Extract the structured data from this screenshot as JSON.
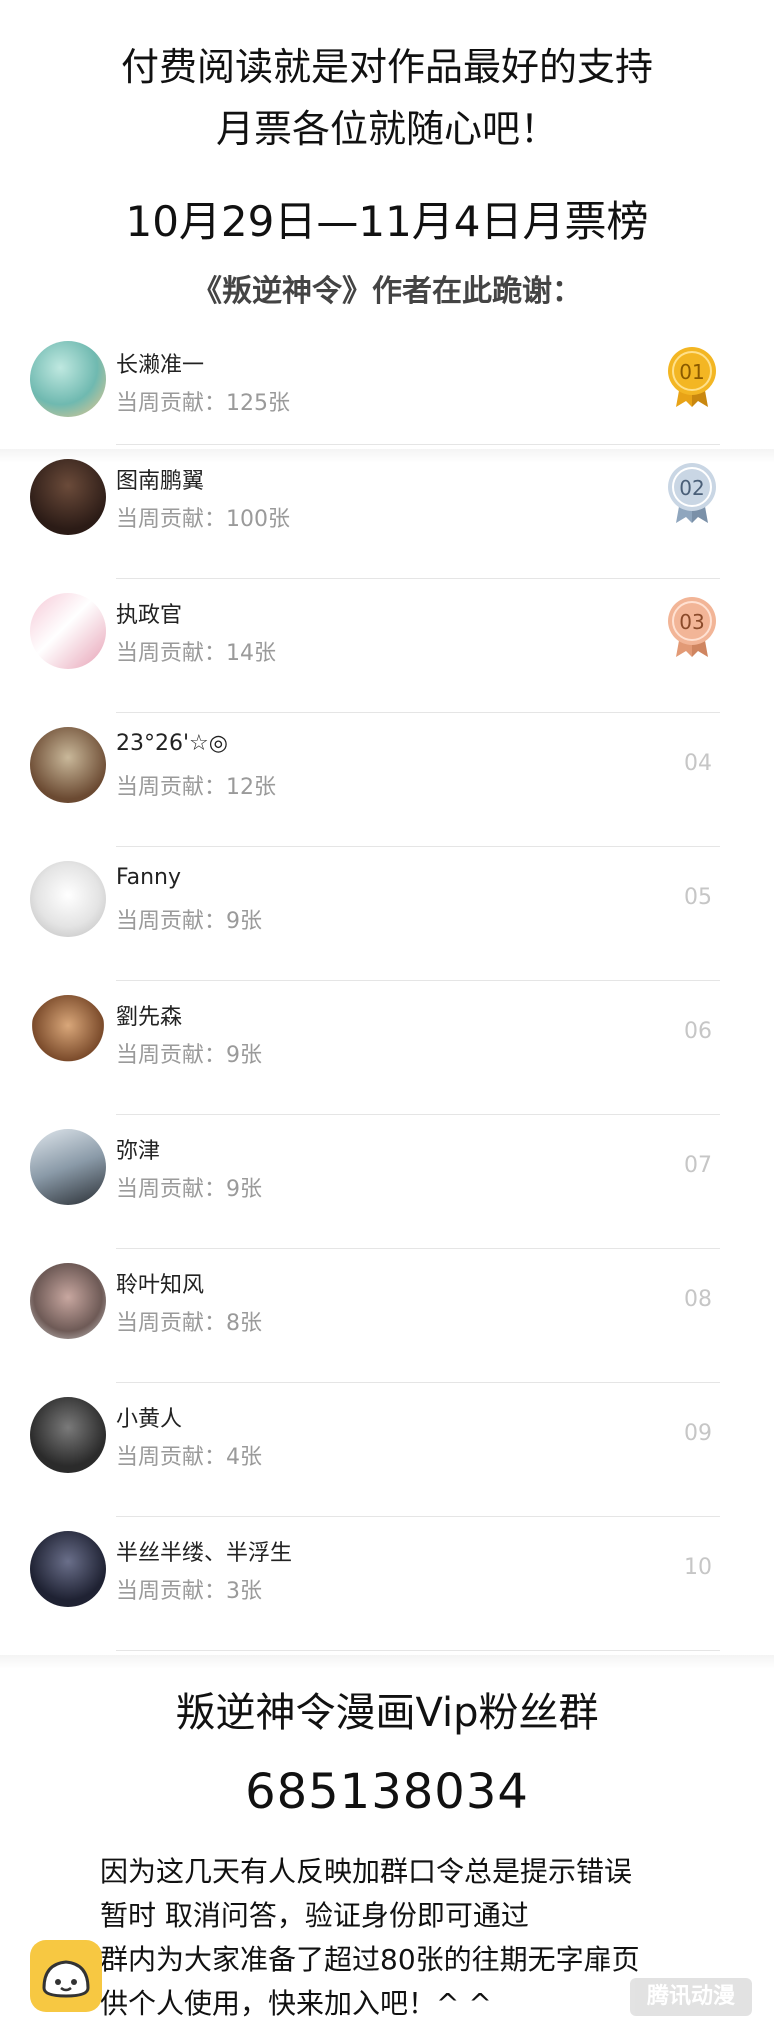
{
  "header": {
    "line1": "付费阅读就是对作品最好的支持",
    "line2": "月票各位就随心吧！",
    "date_range": "10月29日—11月4日月票榜",
    "thanks": "《叛逆神令》作者在此跪谢："
  },
  "leaderboard": {
    "contribution_prefix": "当周贡献：",
    "entries": [
      {
        "rank": "01",
        "name": "长濑准一",
        "contribution": "125张",
        "medal": "gold"
      },
      {
        "rank": "02",
        "name": "图南鹏翼",
        "contribution": "100张",
        "medal": "silver"
      },
      {
        "rank": "03",
        "name": "执政官",
        "contribution": "14张",
        "medal": "bronze"
      },
      {
        "rank": "04",
        "name": "23°26'☆◎",
        "contribution": "12张"
      },
      {
        "rank": "05",
        "name": "Fanny",
        "contribution": "9张"
      },
      {
        "rank": "06",
        "name": "劉先森",
        "contribution": "9张"
      },
      {
        "rank": "07",
        "name": "弥津",
        "contribution": "9张"
      },
      {
        "rank": "08",
        "name": "聆叶知风",
        "contribution": "8张"
      },
      {
        "rank": "09",
        "name": "小黄人",
        "contribution": "4张"
      },
      {
        "rank": "10",
        "name": "半丝半缕、半浮生",
        "contribution": "3张"
      }
    ]
  },
  "fan_group": {
    "title": "叛逆神令漫画Vip粉丝群",
    "number": "685138034",
    "notice_lines": [
      "因为这几天有人反映加群口令总是提示错误",
      "暂时 取消问答，验证身份即可通过",
      "群内为大家准备了超过80张的往期无字扉页",
      "供个人使用，快来加入吧！^ ^"
    ]
  },
  "footer": {
    "watermark": "腾讯动漫"
  },
  "colors": {
    "gold": "#e8a317",
    "silver": "#9fb3c8",
    "bronze": "#e29a76",
    "rank_gray": "#c6c6c6",
    "contribution_gray": "#9a9a9a"
  }
}
